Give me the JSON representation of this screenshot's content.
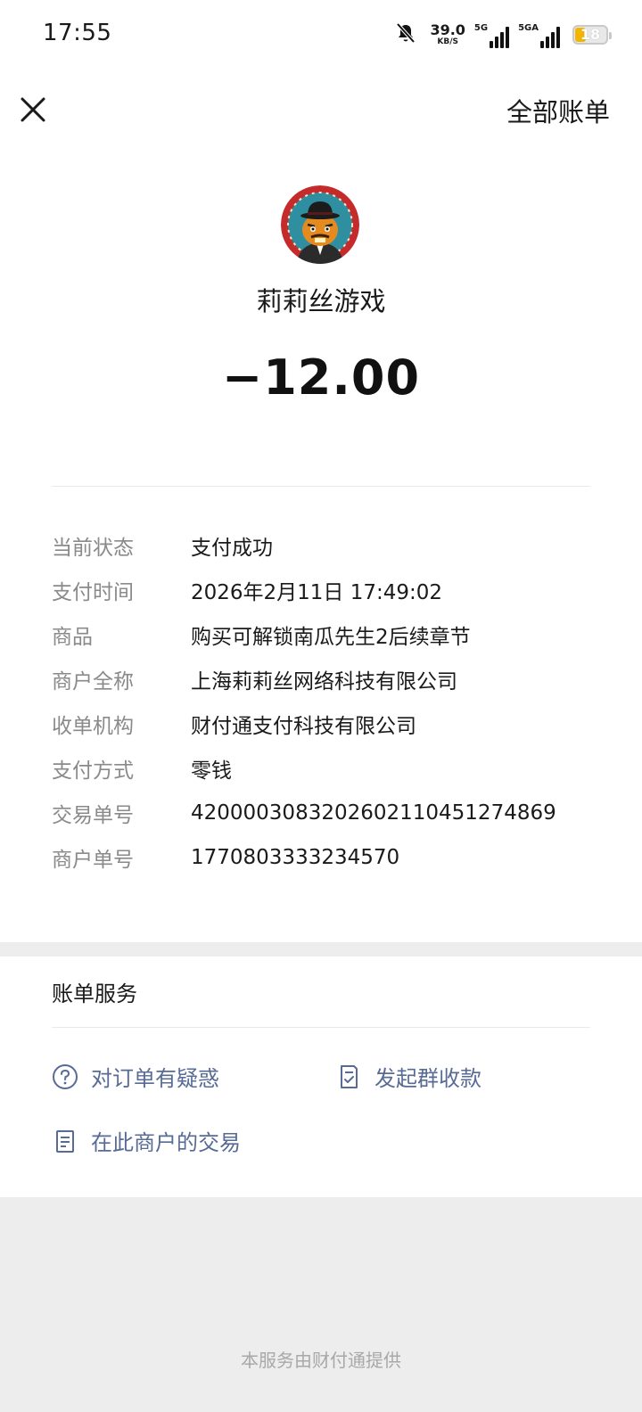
{
  "status_bar": {
    "time": "17:55",
    "net_speed": "39.0",
    "net_speed_unit": "KB/S",
    "sim1_tag": "5G",
    "sim2_tag": "5GA",
    "battery": "18",
    "icons": [
      "bell-muted-icon",
      "signal-icon",
      "battery-icon"
    ]
  },
  "header": {
    "close_icon": "close-icon",
    "all_bills_label": "全部账单"
  },
  "merchant": {
    "name": "莉莉丝游戏",
    "amount": "−12.00"
  },
  "details": [
    {
      "label": "当前状态",
      "value": "支付成功"
    },
    {
      "label": "支付时间",
      "value": "2026年2月11日 17:49:02"
    },
    {
      "label": "商品",
      "value": "购买可解锁南瓜先生2后续章节"
    },
    {
      "label": "商户全称",
      "value": "上海莉莉丝网络科技有限公司"
    },
    {
      "label": "收单机构",
      "value": "财付通支付科技有限公司"
    },
    {
      "label": "支付方式",
      "value": "零钱"
    },
    {
      "label": "交易单号",
      "value": "4200003083202602110451274869"
    },
    {
      "label": "商户单号",
      "value": "1770803333234570"
    }
  ],
  "service": {
    "title": "账单服务",
    "items": [
      {
        "label": "对订单有疑惑",
        "icon": "question-circle-icon"
      },
      {
        "label": "发起群收款",
        "icon": "group-collect-icon"
      },
      {
        "label": "在此商户的交易",
        "icon": "document-icon"
      }
    ]
  },
  "footer": {
    "note": "本服务由财付通提供"
  },
  "colors": {
    "link": "#576b95",
    "label_gray": "#8a8a8a",
    "background": "#ededed",
    "battery": "#f2b600"
  }
}
